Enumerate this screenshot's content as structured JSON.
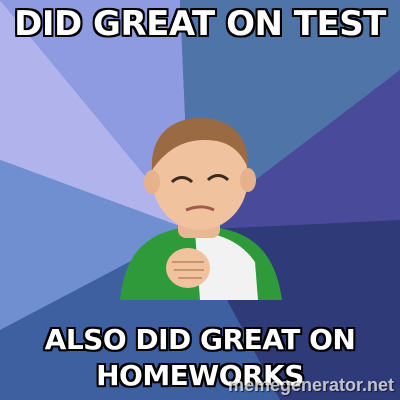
{
  "meme": {
    "top_text": "DID GREAT ON TEST",
    "bottom_text_line1": "ALSO DID GREAT ON",
    "bottom_text_line2": "HOMEWORKS",
    "watermark": "memegenerator.net"
  },
  "colors": {
    "caption_fill": "#ffffff",
    "caption_outline": "#000000",
    "shirt_green": "#2f9a3a",
    "rays": [
      "#7d8fd6",
      "#b1b4ec",
      "#4f75a8",
      "#4a4a9a",
      "#2f3a78"
    ]
  }
}
